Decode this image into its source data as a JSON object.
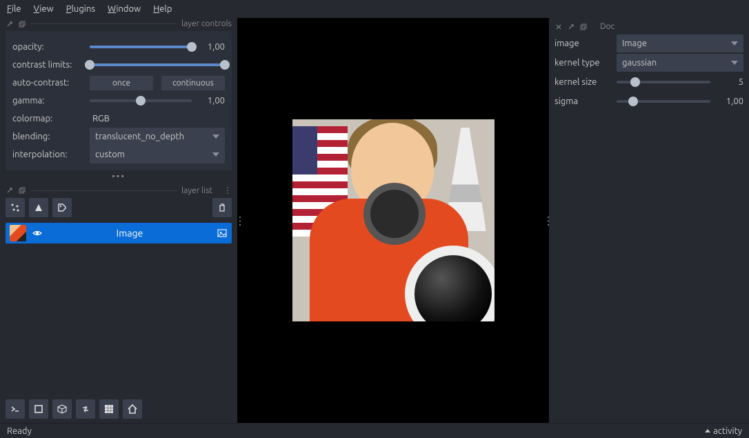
{
  "menu": {
    "items": [
      "File",
      "View",
      "Plugins",
      "Window",
      "Help"
    ]
  },
  "layer_controls": {
    "title": "layer controls",
    "opacity": {
      "label": "opacity:",
      "value": "1,00",
      "pct": 100
    },
    "contrast": {
      "label": "contrast limits:",
      "low": 0,
      "high": 100
    },
    "auto_contrast": {
      "label": "auto-contrast:",
      "once": "once",
      "continuous": "continuous"
    },
    "gamma": {
      "label": "gamma:",
      "value": "1,00",
      "pct": 50
    },
    "colormap": {
      "label": "colormap:",
      "value": "RGB"
    },
    "blending": {
      "label": "blending:",
      "value": "translucent_no_depth"
    },
    "interpolation": {
      "label": "interpolation:",
      "value": "custom"
    }
  },
  "layer_list": {
    "title": "layer list",
    "item": {
      "name": "Image"
    }
  },
  "dock": {
    "title": "Doc",
    "image": {
      "label": "image",
      "value": "Image"
    },
    "kernel_type": {
      "label": "kernel type",
      "value": "gaussian"
    },
    "kernel_size": {
      "label": "kernel size",
      "value": "5",
      "pct": 20
    },
    "sigma": {
      "label": "sigma",
      "value": "1,00",
      "pct": 18
    }
  },
  "status": {
    "ready": "Ready",
    "activity": "activity"
  }
}
